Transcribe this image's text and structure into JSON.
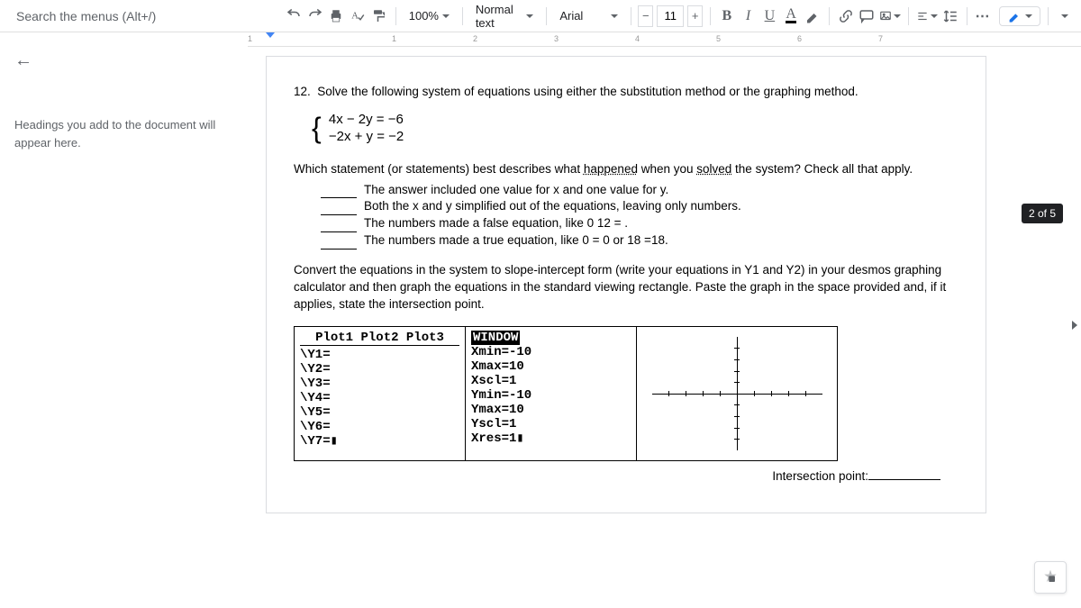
{
  "toolbar": {
    "search_placeholder": "Search the menus (Alt+/)",
    "zoom": "100%",
    "style": "Normal text",
    "font": "Arial",
    "font_size": "11",
    "bold": "B",
    "italic": "I",
    "underline": "U",
    "textcolor": "A"
  },
  "sidebar": {
    "outline_hint": "Headings you add to the document will appear here."
  },
  "ruler": {
    "marks": [
      "1",
      "1",
      "2",
      "3",
      "4",
      "5",
      "6",
      "7"
    ]
  },
  "doc": {
    "q_number": "12.",
    "q_title": "Solve the following system of equations using either the substitution method or the graphing method.",
    "eq1": "4x − 2y = −6",
    "eq2": "−2x + y = −2",
    "which_statement": "Which statement (or statements) best describes what ",
    "happened": "happened",
    "when_you": " when you ",
    "solved": "solved",
    "the_system": " the system? Check all that apply.",
    "checks": [
      "The answer included one value for x and one value for y.",
      "Both the x and y simplified out of the equations, leaving only numbers.",
      "The numbers made a false equation, like 0 12 = .",
      "The numbers made a true equation, like 0 = 0  or 18 =18."
    ],
    "convert_text": "Convert the equations in the system to slope-intercept form (write your equations in Y1 and Y2) in your desmos graphing calculator and then graph the equations in the standard viewing rectangle. Paste the graph in the space provided and, if it applies, state the intersection point.",
    "calc_yeq_header": "Plot1 Plot2 Plot3",
    "calc_y": [
      "\\Y1=",
      "\\Y2=",
      "\\Y3=",
      "\\Y4=",
      "\\Y5=",
      "\\Y6=",
      "\\Y7=▮"
    ],
    "calc_window_header": "WINDOW",
    "calc_window": [
      "Xmin=-10",
      "Xmax=10",
      "Xscl=1",
      "Ymin=-10",
      "Ymax=10",
      "Yscl=1",
      "Xres=1▮"
    ],
    "intersection_label": "Intersection point:"
  },
  "badge": "2 of 5"
}
